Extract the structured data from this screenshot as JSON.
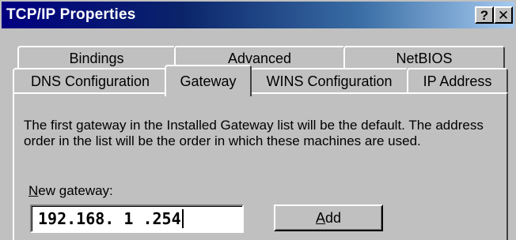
{
  "window": {
    "title": "TCP/IP Properties"
  },
  "caption_buttons": {
    "help": "?",
    "close": "✕"
  },
  "tabs": {
    "row1": [
      {
        "label": "Bindings"
      },
      {
        "label": "Advanced"
      },
      {
        "label": "NetBIOS"
      }
    ],
    "row2": [
      {
        "label": "DNS Configuration"
      },
      {
        "label": "Gateway",
        "active": true
      },
      {
        "label": "WINS Configuration"
      },
      {
        "label": "IP Address"
      }
    ]
  },
  "gateway": {
    "description": "The first gateway in the Installed Gateway list will be the default. The address order in the list will be the order in which these machines are used.",
    "new_gateway_label_accel": "N",
    "new_gateway_label_rest": "ew gateway:",
    "new_gateway_value": "192.168. 1 .254",
    "add_button_accel": "A",
    "add_button_rest": "dd"
  }
}
